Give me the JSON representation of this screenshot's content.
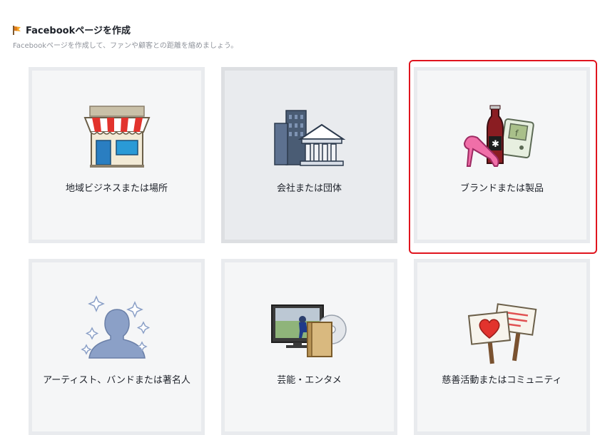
{
  "header": {
    "title": "Facebookページを作成",
    "subtitle": "Facebookページを作成して、ファンや顧客との距離を縮めましょう。"
  },
  "categories": [
    {
      "label": "地域ビジネスまたは場所",
      "icon": "storefront-icon"
    },
    {
      "label": "会社または団体",
      "icon": "office-buildings-icon"
    },
    {
      "label": "ブランドまたは製品",
      "icon": "products-icon"
    },
    {
      "label": "アーティスト、バンドまたは著名人",
      "icon": "celebrity-silhouette-icon"
    },
    {
      "label": "芸能・エンタメ",
      "icon": "entertainment-media-icon"
    },
    {
      "label": "慈善活動またはコミュニティ",
      "icon": "protest-signs-heart-icon"
    }
  ],
  "colors": {
    "highlight": "#e0141e",
    "card_bg": "#f5f6f7",
    "card_hover_bg": "#e9ebee"
  }
}
